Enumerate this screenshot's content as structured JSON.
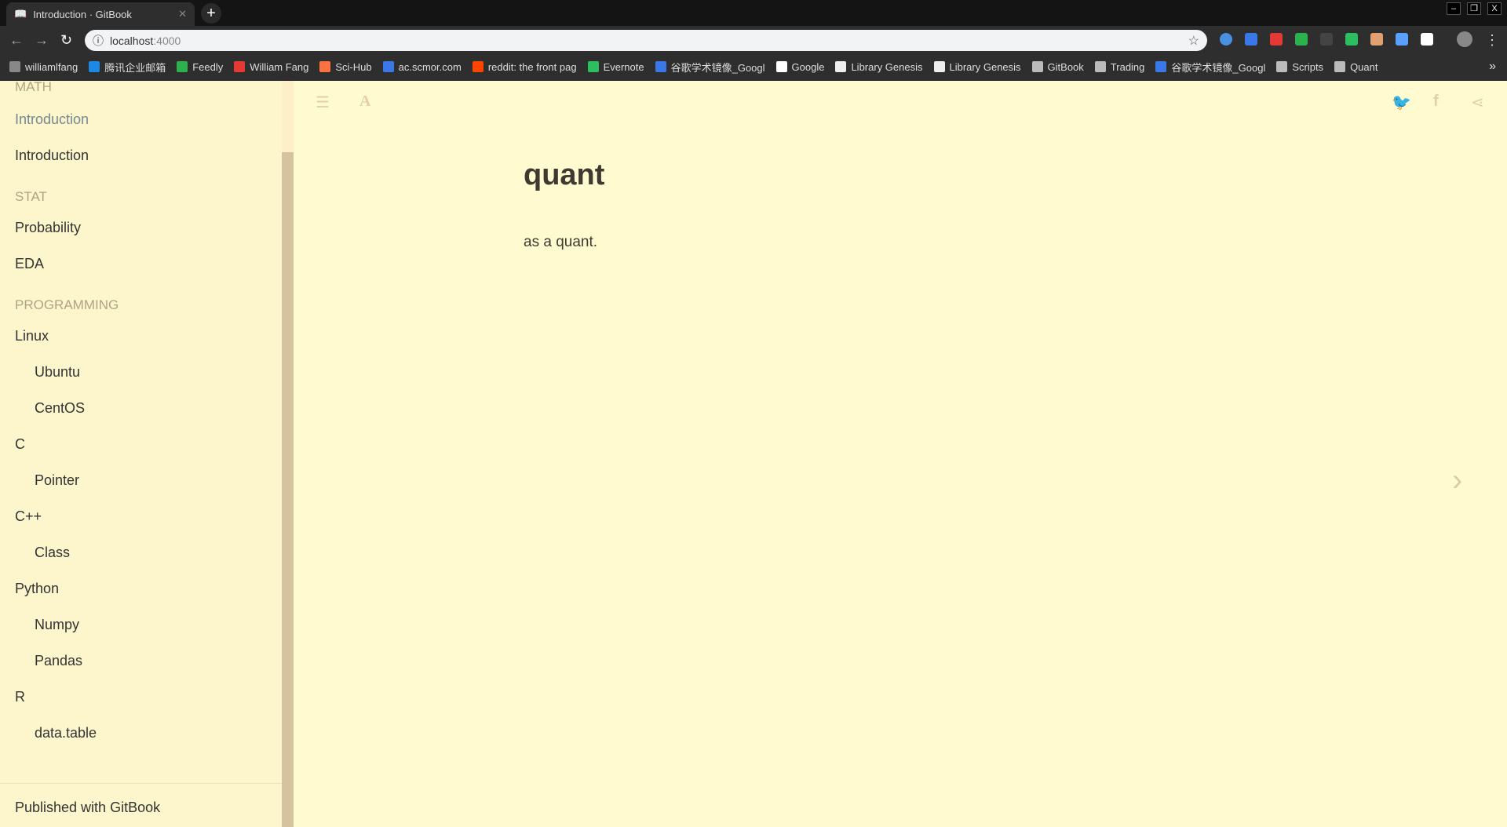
{
  "browser": {
    "tab_title": "Introduction · GitBook",
    "url_host": "localhost",
    "url_port": ":4000",
    "bookmarks": [
      "williamlfang",
      "腾讯企业邮箱",
      "Feedly",
      "William Fang",
      "Sci-Hub",
      "ac.scmor.com",
      "reddit: the front pag",
      "Evernote",
      "谷歌学术镜像_Googl",
      "Google",
      "Library Genesis",
      "Library Genesis",
      "GitBook",
      "Trading",
      "谷歌学术镜像_Googl",
      "Scripts",
      "Quant"
    ],
    "bookmark_colors": [
      "#888",
      "#1e88e5",
      "#2bb24c",
      "#e53935",
      "#ff7043",
      "#3b78e7",
      "#ff4500",
      "#2dbe60",
      "#3b78e7",
      "#fff",
      "#eee",
      "#eee",
      "#bbb",
      "#bbb",
      "#3b78e7",
      "#bbb",
      "#bbb"
    ]
  },
  "sidebar": {
    "sections": [
      {
        "header": "MATH",
        "items": [
          {
            "label": "Introduction",
            "active": true
          },
          {
            "label": "Introduction"
          }
        ]
      },
      {
        "header": "STAT",
        "items": [
          {
            "label": "Probability"
          },
          {
            "label": "EDA"
          }
        ]
      },
      {
        "header": "PROGRAMMING",
        "items": [
          {
            "label": "Linux"
          },
          {
            "label": "Ubuntu",
            "sub": true
          },
          {
            "label": "CentOS",
            "sub": true
          },
          {
            "label": "C"
          },
          {
            "label": "Pointer",
            "sub": true
          },
          {
            "label": "C++"
          },
          {
            "label": "Class",
            "sub": true
          },
          {
            "label": "Python"
          },
          {
            "label": "Numpy",
            "sub": true
          },
          {
            "label": "Pandas",
            "sub": true
          },
          {
            "label": "R"
          },
          {
            "label": "data.table",
            "sub": true
          }
        ]
      }
    ],
    "footer": "Published with GitBook"
  },
  "page": {
    "title": "quant",
    "body": "as a quant."
  },
  "colors": {
    "sidebar_bg": "#fdf6cc",
    "content_bg": "#fffacf",
    "text": "#3f3a31",
    "header": "#b2a285"
  }
}
